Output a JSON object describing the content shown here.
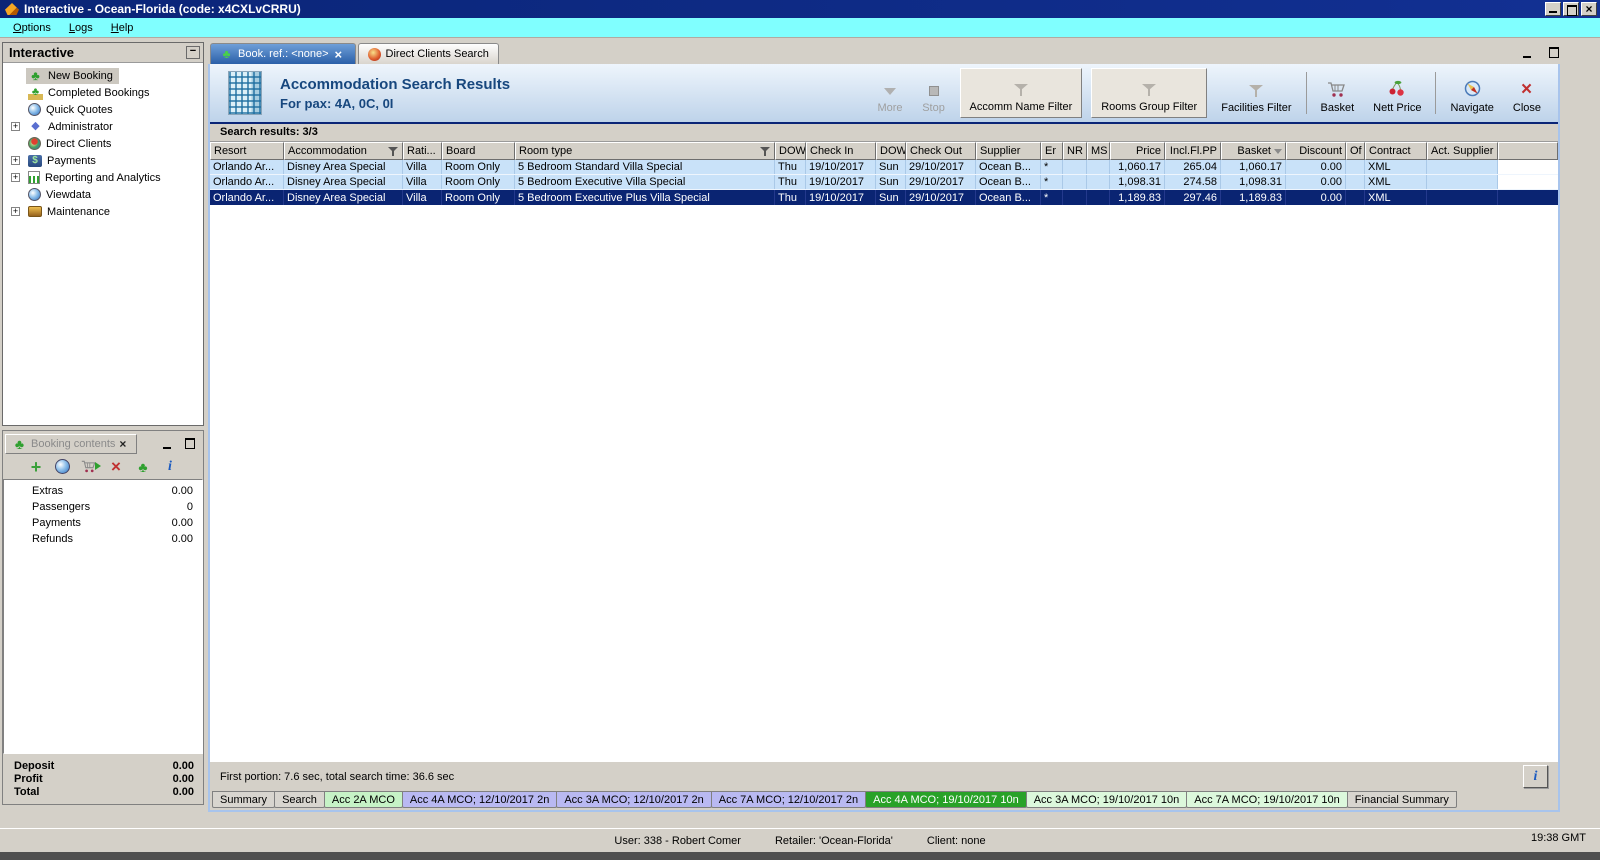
{
  "window": {
    "title": "Interactive - Ocean-Florida (code: x4CXLvCRRU)",
    "menu": [
      "Options",
      "Logs",
      "Help"
    ],
    "clock": "19:38 GMT",
    "status": {
      "user": "User: 338 - Robert Comer",
      "retailer": "Retailer: 'Ocean-Florida'",
      "client": "Client: none"
    }
  },
  "sidebar": {
    "title": "Interactive",
    "items": [
      {
        "label": "New Booking",
        "icon": "palm-tree",
        "cls": "selected"
      },
      {
        "label": "Completed Bookings",
        "icon": "money-palm",
        "cls": ""
      },
      {
        "label": "Quick Quotes",
        "icon": "clock-globe",
        "cls": ""
      },
      {
        "label": "Administrator",
        "icon": "runner",
        "cls": "has-plus"
      },
      {
        "label": "Direct Clients",
        "icon": "globe-red",
        "cls": ""
      },
      {
        "label": "Payments",
        "icon": "money",
        "cls": "has-plus"
      },
      {
        "label": "Reporting and Analytics",
        "icon": "report",
        "cls": "has-plus"
      },
      {
        "label": "Viewdata",
        "icon": "clock-globe",
        "cls": ""
      },
      {
        "label": "Maintenance",
        "icon": "toolbox",
        "cls": "has-plus"
      }
    ]
  },
  "booking_contents": {
    "title": "Booking contents",
    "rows": [
      {
        "label": "Extras",
        "value": "0.00"
      },
      {
        "label": "Passengers",
        "value": "0"
      },
      {
        "label": "Payments",
        "value": "0.00"
      },
      {
        "label": "Refunds",
        "value": "0.00"
      }
    ],
    "totals": [
      {
        "label": "Deposit",
        "value": "0.00"
      },
      {
        "label": "Profit",
        "value": "0.00"
      },
      {
        "label": "Total",
        "value": "0.00"
      }
    ]
  },
  "doc_tabs": [
    {
      "label": "Book. ref.: <none>",
      "cls": "active"
    },
    {
      "label": "Direct Clients Search",
      "cls": ""
    }
  ],
  "results": {
    "title": "Accommodation Search Results",
    "subtitle": "For pax: 4A, 0C, 0I",
    "toolbar": {
      "more": "More",
      "stop": "Stop",
      "accomm_filter": "Accomm Name Filter",
      "rooms_filter": "Rooms Group Filter",
      "facilities_filter": "Facilities Filter",
      "basket": "Basket",
      "nett_price": "Nett Price",
      "navigate": "Navigate",
      "close": "Close"
    },
    "summary": "Search results: 3/3",
    "columns": [
      "Resort",
      "Accommodation",
      "Rati...",
      "Board",
      "Room type",
      "DOW",
      "Check In",
      "DOW",
      "Check Out",
      "Supplier",
      "Er",
      "NR",
      "MS",
      "Price",
      "Incl.Fl.PP",
      "Basket",
      "Discount",
      "Of",
      "Contract",
      "Act. Supplier"
    ],
    "rows": [
      {
        "resort": "Orlando Ar...",
        "accommodation": "Disney Area Special",
        "rating": "Villa",
        "board": "Room Only",
        "room_type": "5 Bedroom Standard Villa Special",
        "dow_in": "Thu",
        "check_in": "19/10/2017",
        "dow_out": "Sun",
        "check_out": "29/10/2017",
        "supplier": "Ocean B...",
        "er": "*",
        "nr": "",
        "ms": "",
        "price": "1,060.17",
        "incl": "265.04",
        "basket": "1,060.17",
        "discount": "0.00",
        "of": "",
        "contract": "XML",
        "act_supplier": "",
        "cls": ""
      },
      {
        "resort": "Orlando Ar...",
        "accommodation": "Disney Area Special",
        "rating": "Villa",
        "board": "Room Only",
        "room_type": "5 Bedroom Executive Villa Special",
        "dow_in": "Thu",
        "check_in": "19/10/2017",
        "dow_out": "Sun",
        "check_out": "29/10/2017",
        "supplier": "Ocean B...",
        "er": "*",
        "nr": "",
        "ms": "",
        "price": "1,098.31",
        "incl": "274.58",
        "basket": "1,098.31",
        "discount": "0.00",
        "of": "",
        "contract": "XML",
        "act_supplier": "",
        "cls": ""
      },
      {
        "resort": "Orlando Ar...",
        "accommodation": "Disney Area Special",
        "rating": "Villa",
        "board": "Room Only",
        "room_type": "5 Bedroom Executive Plus Villa Special",
        "dow_in": "Thu",
        "check_in": "19/10/2017",
        "dow_out": "Sun",
        "check_out": "29/10/2017",
        "supplier": "Ocean B...",
        "er": "*",
        "nr": "",
        "ms": "",
        "price": "1,189.83",
        "incl": "297.46",
        "basket": "1,189.83",
        "discount": "0.00",
        "of": "",
        "contract": "XML",
        "act_supplier": "",
        "cls": "selected"
      }
    ],
    "status": "First portion: 7.6 sec, total search time: 36.6 sec",
    "info_button": "i"
  },
  "bottom_tabs": [
    {
      "label": "Summary",
      "cls": "t-gray"
    },
    {
      "label": "Search",
      "cls": "t-gray"
    },
    {
      "label": "Acc 2A MCO",
      "cls": "t-green"
    },
    {
      "label": "Acc 4A MCO; 12/10/2017 2n",
      "cls": "t-lav"
    },
    {
      "label": "Acc 3A MCO; 12/10/2017 2n",
      "cls": "t-lav"
    },
    {
      "label": "Acc 7A MCO; 12/10/2017 2n",
      "cls": "t-lav"
    },
    {
      "label": "Acc 4A MCO; 19/10/2017 10n",
      "cls": "t-active"
    },
    {
      "label": "Acc 3A MCO; 19/10/2017 10n",
      "cls": "t-pale"
    },
    {
      "label": "Acc 7A MCO; 19/10/2017 10n",
      "cls": "t-pale"
    },
    {
      "label": "Financial Summary",
      "cls": "t-gray"
    }
  ],
  "colors": {
    "titlebar": "#0a2577",
    "menubar": "#80ffff",
    "row_light": "#c9e2f9",
    "row_selected": "#0a2472",
    "tab_active_green": "#28a228",
    "tab_lavender": "#b9b9f2"
  }
}
